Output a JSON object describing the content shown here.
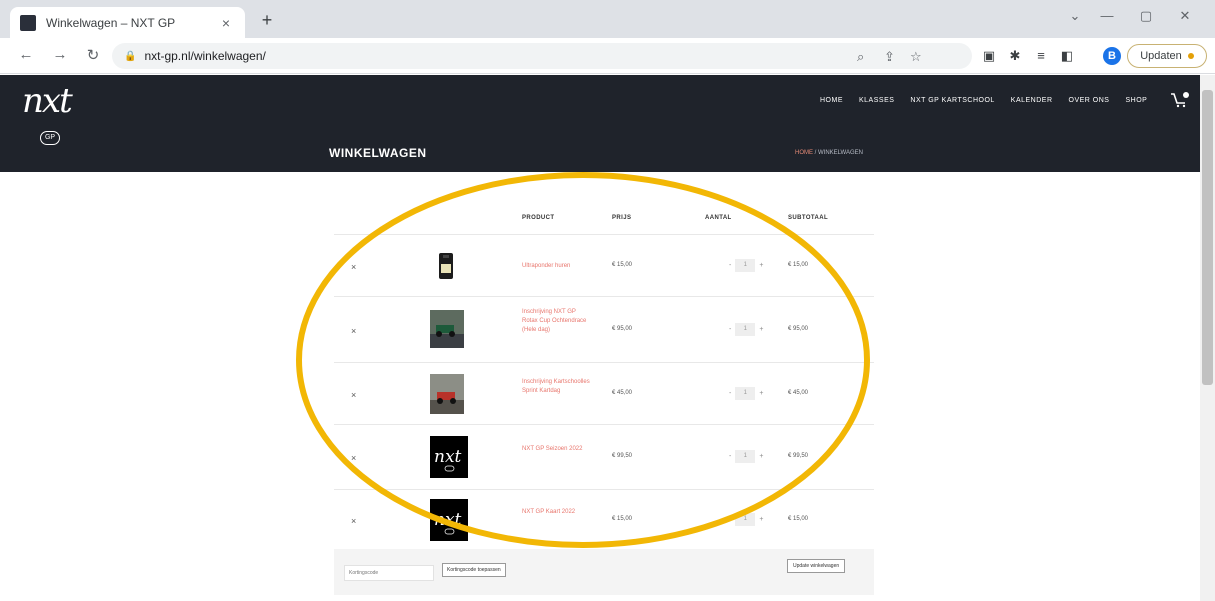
{
  "browser": {
    "tab_title": "Winkelwagen – NXT GP",
    "tab_close": "×",
    "new_tab": "+",
    "url": "nxt-gp.nl/winkelwagen/",
    "profile_initial": "B",
    "update_label": "Updaten",
    "icons": [
      "back-icon",
      "forward-icon",
      "reload-icon",
      "lock-icon",
      "zoom-icon",
      "share-icon",
      "star-icon",
      "extension-icon",
      "puzzle-icon",
      "media-icon",
      "sidepanel-icon"
    ]
  },
  "site": {
    "logo_text": "nxt",
    "logo_badge": "GP",
    "nav": [
      "HOME",
      "KLASSES",
      "NXT GP KARTSCHOOL",
      "KALENDER",
      "OVER ONS",
      "SHOP"
    ],
    "page_title": "WINKELWAGEN",
    "breadcrumb_home": "HOME",
    "breadcrumb_current": " / WINKELWAGEN"
  },
  "cart": {
    "headers": [
      "PRODUCT",
      "PRIJS",
      "AANTAL",
      "SUBTOTAAL"
    ],
    "remove_symbol": "×",
    "qty_minus": "-",
    "qty_plus": "+",
    "items": [
      {
        "name": "Ultraponder huren",
        "price": "€ 15,00",
        "qty": "1",
        "subtotal": "€ 15,00",
        "thumb": "transponder"
      },
      {
        "name": "Inschrijving NXT GP Rotax Cup Ochtendrace (Hele dag)",
        "price": "€ 95,00",
        "qty": "1",
        "subtotal": "€ 95,00",
        "thumb": "kart-photo"
      },
      {
        "name": "Inschrijving Kartschoolles Sprint Kartdag",
        "price": "€ 45,00",
        "qty": "1",
        "subtotal": "€ 45,00",
        "thumb": "kart-photo-2"
      },
      {
        "name": "NXT GP Seizoen 2022",
        "price": "€ 99,50",
        "qty": "1",
        "subtotal": "€ 99,50",
        "thumb": "logo"
      },
      {
        "name": "NXT GP Kaart 2022",
        "price": "€ 15,00",
        "qty": "1",
        "subtotal": "€ 15,00",
        "thumb": "logo"
      }
    ],
    "coupon_placeholder": "Kortingscode",
    "apply_label": "Kortingscode toepassen",
    "update_label": "Update winkelwagen"
  },
  "colors": {
    "header_bg": "#1f232b",
    "link": "#e8766d",
    "annotation": "#f2b705"
  }
}
